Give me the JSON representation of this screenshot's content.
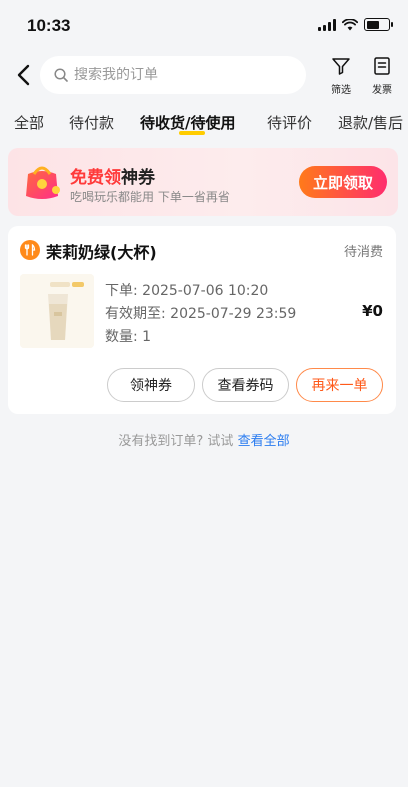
{
  "status_bar": {
    "time": "10:33"
  },
  "search": {
    "placeholder": "搜索我的订单"
  },
  "actions": {
    "filter": "筛选",
    "invoice": "发票"
  },
  "tabs": [
    {
      "label": "全部"
    },
    {
      "label": "待付款"
    },
    {
      "label": "待收货/待使用",
      "active": true
    },
    {
      "label": "待评价"
    },
    {
      "label": "退款/售后"
    }
  ],
  "promo": {
    "title_highlight": "免费领",
    "title_rest": "神券",
    "subtitle": "吃喝玩乐都能用 下单一省再省",
    "button": "立即领取"
  },
  "order": {
    "shop_name": "茉莉奶绿(大杯)",
    "status": "待消费",
    "order_time": "下单: 2025-07-06 10:20",
    "valid_until": "有效期至: 2025-07-29 23:59",
    "quantity": "数量: 1",
    "price": "¥0",
    "buttons": {
      "coupon": "领神券",
      "view_code": "查看券码",
      "reorder": "再来一单"
    }
  },
  "hint": {
    "text": "没有找到订单? 试试",
    "link": "查看全部"
  },
  "colors": {
    "accent_yellow": "#ffcc00",
    "promo_red": "#ff3a3a",
    "link_blue": "#2a7cf0",
    "orange": "#ff5a1a"
  }
}
